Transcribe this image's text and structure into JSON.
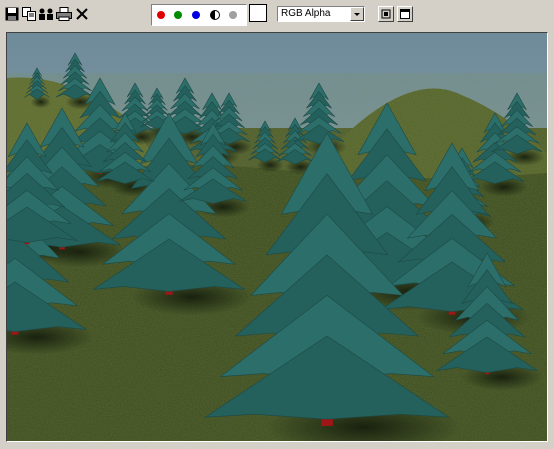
{
  "toolbar": {
    "save_icon": "floppy-disk-icon",
    "copy_icon": "copy-icon",
    "clone_icon": "clone-window-icon",
    "print_icon": "printer-icon",
    "clear_icon": "clear-x-icon",
    "channels": [
      {
        "name": "red",
        "color": "#e00000"
      },
      {
        "name": "green",
        "color": "#008a00"
      },
      {
        "name": "blue",
        "color": "#0000e0"
      }
    ],
    "mono_icon": "monochrome-icon",
    "clear_color_icon": "gray-dot-icon",
    "swatch_color": "#ffffff",
    "channel_select": "RGB Alpha",
    "right_buttons": [
      "display-icon",
      "window-icon"
    ]
  },
  "render": {
    "sky_top": "#6f8b9a",
    "sky_bottom": "#9aa6ab",
    "ground": "#3d4a1e",
    "tree_color": "#2c6e6a",
    "trunk_color": "#a01515"
  }
}
